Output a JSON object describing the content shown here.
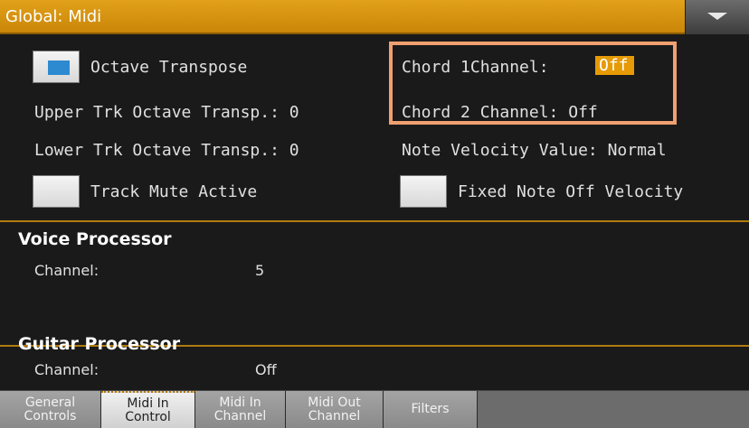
{
  "header": {
    "title": "Global: Midi",
    "menu_icon": "triangle-down-icon"
  },
  "general": {
    "octave_transpose_label": "Octave Transpose",
    "octave_transpose_checked": true,
    "upper_trk_label": "Upper Trk Octave Transp.: 0",
    "lower_trk_label": "Lower Trk Octave Transp.: 0",
    "track_mute_label": "Track Mute Active",
    "track_mute_checked": false,
    "chord1_label": "Chord 1Channel:",
    "chord1_value": "Off",
    "chord2_label": "Chord 2 Channel: Off",
    "note_velocity_label": "Note Velocity Value: Normal",
    "fixed_note_label": "Fixed Note Off Velocity",
    "fixed_note_checked": false
  },
  "voice_processor": {
    "title": "Voice Processor",
    "channel_label": "Channel:",
    "channel_value": "5"
  },
  "guitar_processor": {
    "title": "Guitar Processor",
    "channel_label": "Channel:",
    "channel_value": "Off"
  },
  "tabs": [
    {
      "label": "General\nControls",
      "active": false
    },
    {
      "label": "Midi In\nControl",
      "active": true
    },
    {
      "label": "Midi In\nChannel",
      "active": false
    },
    {
      "label": "Midi Out\nChannel",
      "active": false
    },
    {
      "label": "Filters",
      "active": false
    }
  ],
  "colors": {
    "accent": "#e69a05",
    "highlight_box": "#f0a070",
    "checkbox_mark": "#2e8ad0"
  }
}
